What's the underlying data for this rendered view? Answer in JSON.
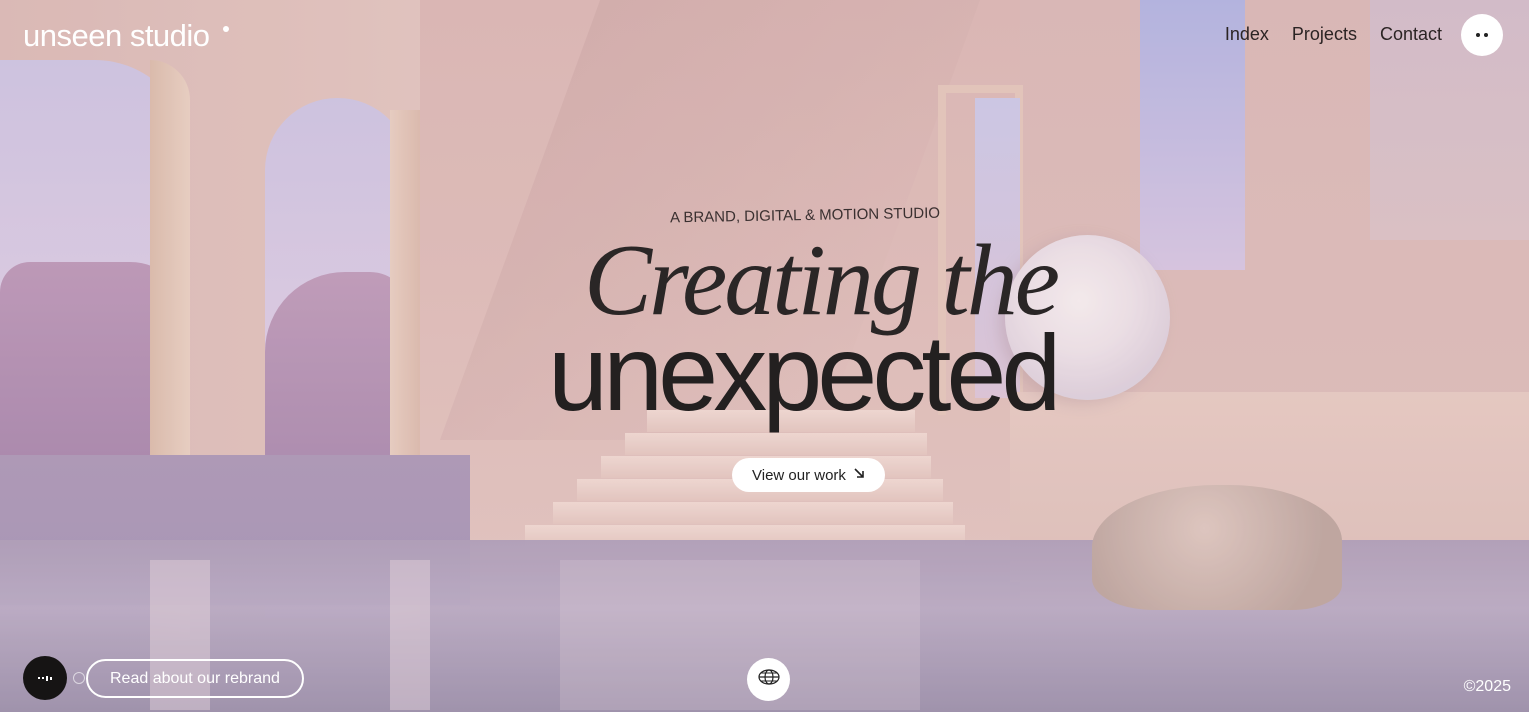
{
  "header": {
    "logo": "unseen studio",
    "nav": [
      "Index",
      "Projects",
      "Contact"
    ],
    "menu_icon": "dots-menu-icon"
  },
  "hero": {
    "eyebrow": "A BRAND, DIGITAL & MOTION STUDIO",
    "title_line1": "Creating the",
    "title_line2": "unexpected",
    "cta_label": "View our work",
    "cta_icon": "arrow-down-right-icon"
  },
  "footer": {
    "sound_icon": "sound-wave-icon",
    "rebrand_label": "Read about our rebrand",
    "globe_icon": "globe-icon",
    "copyright": "©2025"
  }
}
